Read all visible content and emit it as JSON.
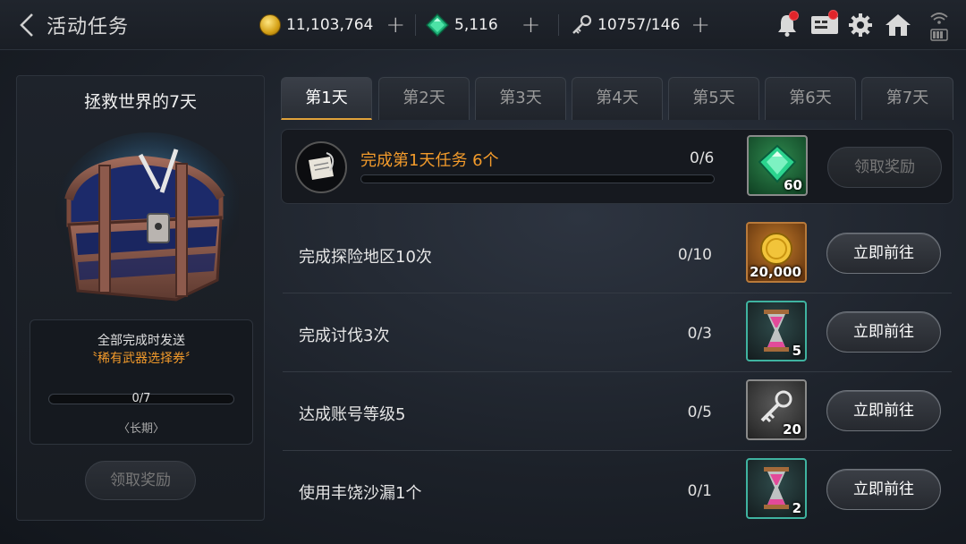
{
  "header": {
    "title": "活动任务",
    "gold": "11,103,764",
    "gems": "5,116",
    "keys": "10757/146",
    "plus": "+"
  },
  "event": {
    "title": "拯救世界的7天",
    "reward_desc": "全部完成时发送",
    "reward_name": "〝稀有武器选择券〞",
    "progress": "0/7",
    "progress_fraction": 0,
    "period": "〈长期〉",
    "claim_label": "领取奖励"
  },
  "tabs": [
    {
      "label": "第1天",
      "active": true
    },
    {
      "label": "第2天",
      "active": false
    },
    {
      "label": "第3天",
      "active": false
    },
    {
      "label": "第4天",
      "active": false
    },
    {
      "label": "第5天",
      "active": false
    },
    {
      "label": "第6天",
      "active": false
    },
    {
      "label": "第7天",
      "active": false
    }
  ],
  "main_task": {
    "name": "完成第1天任务  6个",
    "progress": "0/6",
    "progress_fraction": 0,
    "reward_icon": "gem-icon",
    "reward_qty": "60",
    "button_label": "领取奖励"
  },
  "tasks": [
    {
      "name": "完成探险地区10次",
      "progress": "0/10",
      "reward_icon": "gold-coin-icon",
      "reward_qty": "20,000",
      "button_label": "立即前往"
    },
    {
      "name": "完成讨伐3次",
      "progress": "0/3",
      "reward_icon": "hourglass-icon",
      "reward_qty": "5",
      "button_label": "立即前往"
    },
    {
      "name": "达成账号等级5",
      "progress": "0/5",
      "reward_icon": "key-icon",
      "reward_qty": "20",
      "button_label": "立即前往"
    },
    {
      "name": "使用丰饶沙漏1个",
      "progress": "0/1",
      "reward_icon": "hourglass-icon",
      "reward_qty": "2",
      "button_label": "立即前往"
    }
  ],
  "colors": {
    "accent_orange": "#f39b2b",
    "tab_active_underline": "#e0a23a",
    "notification_red": "#e0242a"
  }
}
